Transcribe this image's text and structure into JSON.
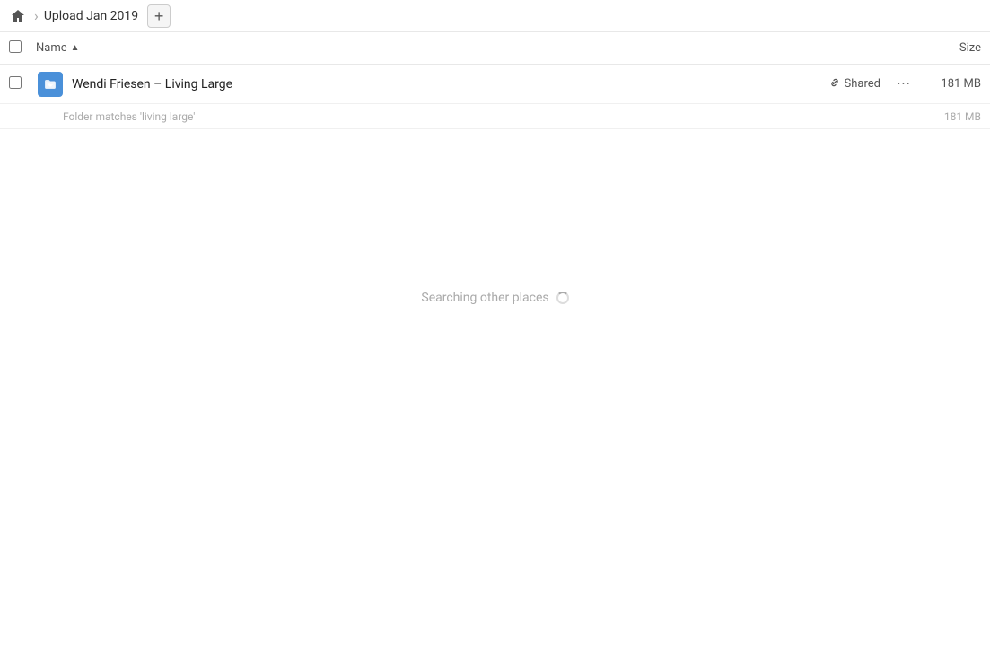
{
  "breadcrumb": {
    "title": "Upload Jan 2019",
    "home_label": "Home"
  },
  "new_folder_button": {
    "label": "+"
  },
  "columns": {
    "name_label": "Name",
    "size_label": "Size",
    "sort_arrow": "▲"
  },
  "file_row": {
    "name": "Wendi Friesen – Living Large",
    "shared_label": "Shared",
    "size": "181 MB",
    "more_label": "···",
    "sub_info": "Folder matches 'living large'",
    "sub_size": "181 MB"
  },
  "searching": {
    "text": "Searching other places"
  },
  "icons": {
    "home": "🏠",
    "link": "🔗",
    "folder_glyph": "✦"
  }
}
